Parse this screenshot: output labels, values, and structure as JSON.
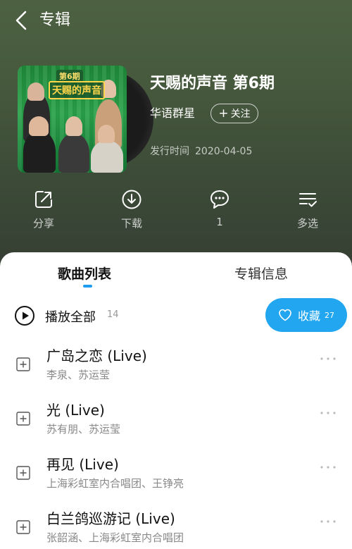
{
  "header": {
    "title": "专辑"
  },
  "album": {
    "cover_badge": "第6期",
    "cover_logo": "天赐的声音",
    "title": "天赐的声音 第6期",
    "artist": "华语群星",
    "follow_label": "关注",
    "release_label": "发行时间",
    "release_date": "2020-04-05"
  },
  "actions": [
    {
      "label": "分享",
      "icon": "share-icon"
    },
    {
      "label": "下载",
      "icon": "download-icon"
    },
    {
      "label": "1",
      "icon": "comment-icon"
    },
    {
      "label": "多选",
      "icon": "multi-select-icon"
    }
  ],
  "tabs": {
    "active": "歌曲列表",
    "inactive": "专辑信息"
  },
  "play_all": {
    "label": "播放全部",
    "count": "14"
  },
  "collect": {
    "label": "收藏",
    "count": "27"
  },
  "songs": [
    {
      "title": "广岛之恋 (Live)",
      "artist": "李泉、苏运莹"
    },
    {
      "title": "光 (Live)",
      "artist": "苏有朋、苏运莹"
    },
    {
      "title": "再见 (Live)",
      "artist": "上海彩虹室内合唱团、王铮亮"
    },
    {
      "title": "白兰鸽巡游记 (Live)",
      "artist": "张韶涵、上海彩虹室内合唱团"
    }
  ],
  "colors": {
    "accent": "#22a6f0",
    "tab_indicator": "#1e9cf0"
  }
}
